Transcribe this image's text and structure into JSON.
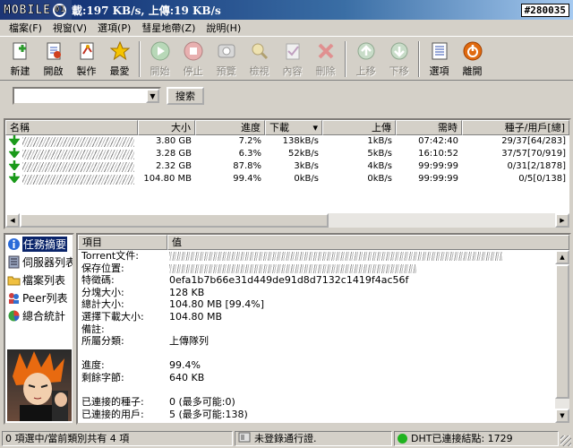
{
  "titlebar": {
    "logo": "MOBILE",
    "logo_mark": "01",
    "title": "載:197 KB/s, 上傳:19 KB/s",
    "watermark": "#280035"
  },
  "menu": [
    "檔案(F)",
    "視窗(V)",
    "選項(P)",
    "彗星地帶(Z)",
    "說明(H)"
  ],
  "toolbar": {
    "new": "新建",
    "open": "開啟",
    "make": "製作",
    "favorite": "最愛",
    "start": "開始",
    "stop": "停止",
    "preview": "預覽",
    "check": "檢視",
    "content": "內容",
    "delete": "刪除",
    "move_up": "上移",
    "move_down": "下移",
    "options": "選項",
    "exit": "離開"
  },
  "search": {
    "value": "",
    "button": "搜索"
  },
  "torrent_list": {
    "columns": [
      "名稱",
      "大小",
      "進度",
      "下載",
      "上傳",
      "需時",
      "種子/用戶[總]"
    ],
    "rows": [
      {
        "size": "3.80 GB",
        "progress": "7.2%",
        "down": "138kB/s",
        "up": "1kB/s",
        "eta": "07:42:40",
        "seeds": "29/37[64/283]"
      },
      {
        "size": "3.28 GB",
        "progress": "6.3%",
        "down": "52kB/s",
        "up": "5kB/s",
        "eta": "16:10:52",
        "seeds": "37/57[70/919]"
      },
      {
        "size": "2.32 GB",
        "progress": "87.8%",
        "down": "3kB/s",
        "up": "4kB/s",
        "eta": "99:99:99",
        "seeds": "0/31[2/1878]"
      },
      {
        "size": "104.80 MB",
        "progress": "99.4%",
        "down": "0kB/s",
        "up": "0kB/s",
        "eta": "99:99:99",
        "seeds": "0/5[0/138]"
      }
    ]
  },
  "sidebar": [
    {
      "label": "任務摘要",
      "icon": "info-icon"
    },
    {
      "label": "伺服器列表",
      "icon": "server-icon"
    },
    {
      "label": "檔案列表",
      "icon": "folder-icon"
    },
    {
      "label": "Peer列表",
      "icon": "peers-icon"
    },
    {
      "label": "總合統計",
      "icon": "pie-chart-icon"
    }
  ],
  "detail": {
    "columns": [
      "項目",
      "值"
    ],
    "rows": [
      {
        "k": "Torrent文件:",
        "v": ""
      },
      {
        "k": "保存位置:",
        "v": ""
      },
      {
        "k": "特徵碼:",
        "v": "0efa1b7b66e31d449de91d8d7132c1419f4ac56f"
      },
      {
        "k": "分塊大小:",
        "v": "128 KB"
      },
      {
        "k": "總計大小:",
        "v": "104.80 MB [99.4%]"
      },
      {
        "k": "選擇下載大小:",
        "v": "104.80 MB"
      },
      {
        "k": "備註:",
        "v": ""
      },
      {
        "k": "所屬分類:",
        "v": "上傳隊列"
      },
      {
        "k": "",
        "v": ""
      },
      {
        "k": "進度:",
        "v": "99.4%"
      },
      {
        "k": "剩餘字節:",
        "v": "640 KB"
      },
      {
        "k": "",
        "v": ""
      },
      {
        "k": "已連接的種子:",
        "v": "0 (最多可能:0)"
      },
      {
        "k": "已連接的用戶:",
        "v": "5 (最多可能:138)"
      }
    ]
  },
  "status": {
    "left": "0 項選中/當前類別共有 4 項",
    "login": "未登錄通行證.",
    "dht": "DHT已連接結點: 1729"
  },
  "colors": {
    "title_start": "#0a246a",
    "selection": "#0a246a",
    "dht_ok": "#1fb31f"
  }
}
